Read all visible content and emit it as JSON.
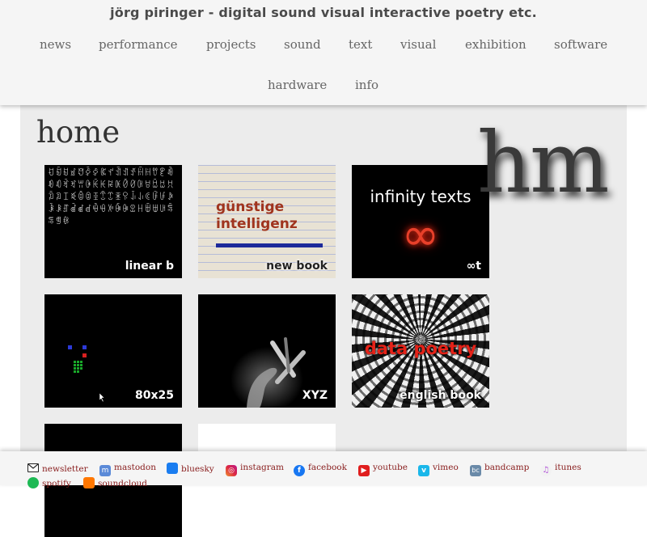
{
  "site": {
    "title": "jörg piringer - digital sound visual interactive poetry etc."
  },
  "nav": [
    {
      "label": "news"
    },
    {
      "label": "performance"
    },
    {
      "label": "projects"
    },
    {
      "label": "sound"
    },
    {
      "label": "text"
    },
    {
      "label": "visual"
    },
    {
      "label": "exhibition"
    },
    {
      "label": "software"
    },
    {
      "label": "hardware"
    },
    {
      "label": "info"
    }
  ],
  "page": {
    "title": "home",
    "logo_text": "hm"
  },
  "tiles": {
    "linear_b": {
      "label": "linear b",
      "glyphs": "ꀀꀁꀂꀃꀄꀅꀆꀇꀈꀉꀊꀋꀌꀍꀎꀏꀐꀑꀒꀓꀔꀕꀖꀗꀘꀙꀚꀛꀜꀝꀞꀟꀠꀡꀢꀣꀤꀥꀦꀧꀨꀩꀪꀫꀬꀭꀮꀯꀰꀱꀲꀳꀴꀵꀶꀷꀸꀹꀺꀻꀼꀽꀾꀿꁀꁁꁂꁃꁄꁅꁆ"
    },
    "new_book": {
      "label": "new book",
      "line1": "günstige",
      "line2": "intelligenz"
    },
    "infinity": {
      "label": "∞t",
      "title": "infinity texts",
      "symbol": "∞"
    },
    "t80x25": {
      "label": "80x25"
    },
    "xyz": {
      "label": "XYZ"
    },
    "english_book": {
      "label": "english book",
      "title": "data poetry"
    }
  },
  "footer": {
    "links": [
      {
        "label": "newsletter",
        "icon": "envelope-icon"
      },
      {
        "label": "mastodon",
        "icon": "mastodon-icon"
      },
      {
        "label": "bluesky",
        "icon": "bluesky-icon"
      },
      {
        "label": "instagram",
        "icon": "instagram-icon"
      },
      {
        "label": "facebook",
        "icon": "facebook-icon"
      },
      {
        "label": "youtube",
        "icon": "youtube-icon"
      },
      {
        "label": "vimeo",
        "icon": "vimeo-icon"
      },
      {
        "label": "bandcamp",
        "icon": "bandcamp-icon"
      },
      {
        "label": "itunes",
        "icon": "itunes-icon"
      },
      {
        "label": "spotify",
        "icon": "spotify-icon"
      },
      {
        "label": "soundcloud",
        "icon": "soundcloud-icon"
      }
    ]
  },
  "colors": {
    "link": "#8a2020",
    "header_bg": "#f5f5f5",
    "main_bg": "#ececec",
    "book_title": "#a0341e",
    "book_bar": "#1d2a9a",
    "data_poetry": "#e52218",
    "infinity": "#e8402a"
  }
}
